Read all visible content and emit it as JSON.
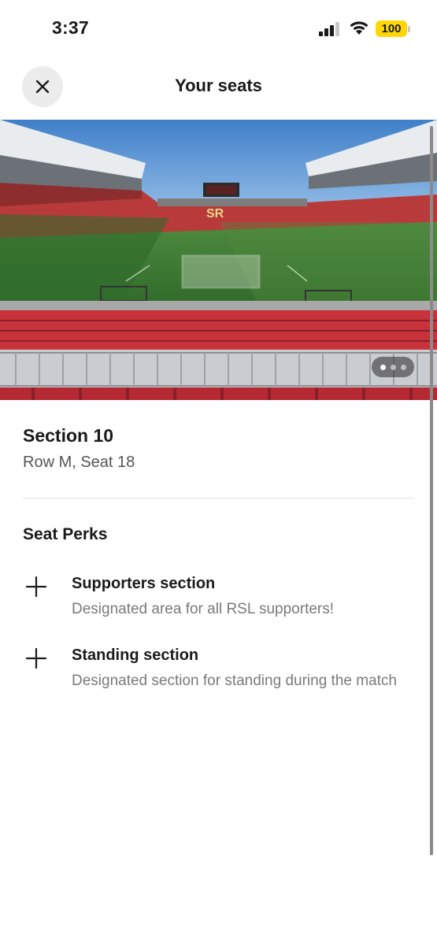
{
  "status_bar": {
    "time": "3:37",
    "battery": "100",
    "icons": [
      "signal-icon",
      "wifi-icon",
      "battery-icon"
    ]
  },
  "header": {
    "title": "Your seats",
    "close_icon": "close-icon"
  },
  "hero": {
    "pager": {
      "count": 3,
      "active": 1
    }
  },
  "seat": {
    "section": "Section 10",
    "details": "Row M, Seat 18"
  },
  "perks": {
    "heading": "Seat Perks",
    "items": [
      {
        "icon": "plus-icon",
        "title": "Supporters section",
        "description": "Designated area for all RSL supporters!"
      },
      {
        "icon": "plus-icon",
        "title": "Standing section",
        "description": "Designated section for standing during the match"
      }
    ]
  },
  "colors": {
    "battery": "#ffd60a",
    "seat_red": "#c8323a",
    "pitch_green": "#3d7a34",
    "text_primary": "#1a1a1a",
    "text_secondary": "#7a7a7a"
  }
}
